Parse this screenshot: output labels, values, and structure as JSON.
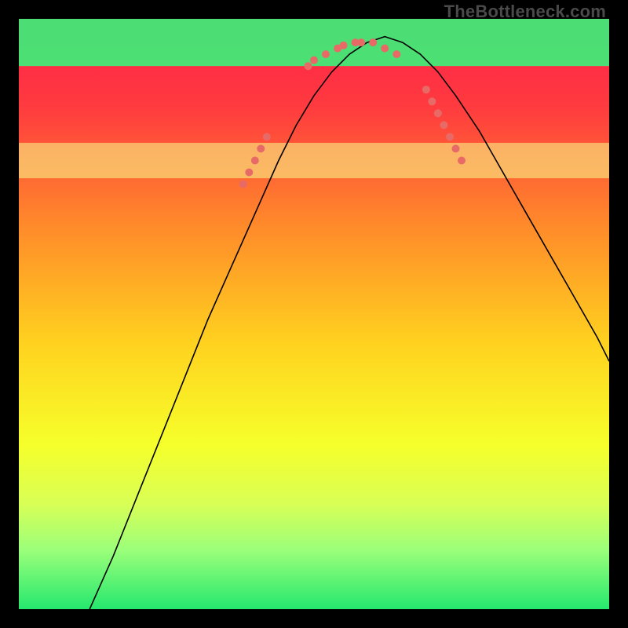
{
  "watermark": "TheBottleneck.com",
  "chart_data": {
    "type": "line",
    "title": "",
    "xlabel": "",
    "ylabel": "",
    "xlim": [
      0,
      100
    ],
    "ylim": [
      0,
      100
    ],
    "grid": false,
    "legend": false,
    "background_gradient": {
      "stops": [
        {
          "offset": 0.0,
          "color": "#ff1f4b"
        },
        {
          "offset": 0.15,
          "color": "#ff3b3f"
        },
        {
          "offset": 0.35,
          "color": "#ff8a2a"
        },
        {
          "offset": 0.55,
          "color": "#ffd21f"
        },
        {
          "offset": 0.72,
          "color": "#f6ff2a"
        },
        {
          "offset": 0.82,
          "color": "#d9ff55"
        },
        {
          "offset": 0.9,
          "color": "#9bff7a"
        },
        {
          "offset": 1.0,
          "color": "#25e86e"
        }
      ]
    },
    "bottom_bands": [
      {
        "y_top": 73,
        "y_bottom": 79,
        "color": "#f8ff8a",
        "opacity": 0.55
      },
      {
        "y_top": 92,
        "y_bottom": 100,
        "color": "#2dff7d",
        "opacity": 0.85
      }
    ],
    "series": [
      {
        "name": "curve",
        "stroke": "#000000",
        "stroke_width": 1.6,
        "x": [
          12,
          16,
          20,
          24,
          28,
          32,
          36,
          40,
          44,
          47,
          50,
          53,
          56,
          59,
          62,
          65,
          68,
          71,
          74,
          78,
          82,
          86,
          90,
          94,
          98,
          100
        ],
        "y": [
          0,
          9,
          19,
          29,
          39,
          49,
          58,
          67,
          76,
          82,
          87,
          91,
          94,
          96,
          97,
          96,
          94,
          91,
          87,
          81,
          74,
          67,
          60,
          53,
          46,
          42
        ]
      }
    ],
    "markers": {
      "color": "#e86a66",
      "radius": 5,
      "points": [
        {
          "x": 38,
          "y": 72
        },
        {
          "x": 39,
          "y": 74
        },
        {
          "x": 40,
          "y": 76
        },
        {
          "x": 41,
          "y": 78
        },
        {
          "x": 42,
          "y": 80
        },
        {
          "x": 49,
          "y": 92
        },
        {
          "x": 50,
          "y": 93
        },
        {
          "x": 52,
          "y": 94
        },
        {
          "x": 54,
          "y": 95
        },
        {
          "x": 55,
          "y": 95.5
        },
        {
          "x": 57,
          "y": 96
        },
        {
          "x": 58,
          "y": 96
        },
        {
          "x": 60,
          "y": 96
        },
        {
          "x": 62,
          "y": 95
        },
        {
          "x": 64,
          "y": 94
        },
        {
          "x": 69,
          "y": 88
        },
        {
          "x": 70,
          "y": 86
        },
        {
          "x": 71,
          "y": 84
        },
        {
          "x": 72,
          "y": 82
        },
        {
          "x": 73,
          "y": 80
        },
        {
          "x": 74,
          "y": 78
        },
        {
          "x": 75,
          "y": 76
        }
      ]
    }
  }
}
